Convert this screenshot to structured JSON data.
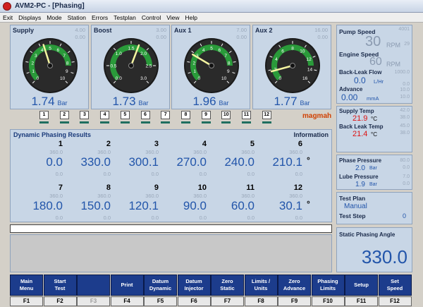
{
  "window": {
    "title": "AVM2-PC - [Phasing]"
  },
  "menu": [
    "Exit",
    "Displays",
    "Mode",
    "Station",
    "Errors",
    "Testplan",
    "Control",
    "View",
    "Help"
  ],
  "gauges": [
    {
      "title": "Supply",
      "max": "4.00",
      "min": "0.00",
      "value": "1.74",
      "unit": "Bar",
      "fraction": 0.435,
      "ticks": [
        "0",
        "1",
        "2",
        "3",
        "4",
        "5",
        "6",
        "7",
        "8",
        "9",
        "10"
      ]
    },
    {
      "title": "Boost",
      "max": "3.00",
      "min": "0.00",
      "value": "1.73",
      "unit": "Bar",
      "fraction": 0.577,
      "ticks": [
        "0.0",
        "0.5",
        "1.0",
        "1.5",
        "2.0",
        "2.5",
        "3.0"
      ]
    },
    {
      "title": "Aux 1",
      "max": "7.00",
      "min": "0.00",
      "value": "1.96",
      "unit": "Bar",
      "fraction": 0.28,
      "ticks": [
        "0",
        "1",
        "2",
        "3",
        "4",
        "5",
        "6",
        "7",
        "8",
        "9",
        "10"
      ]
    },
    {
      "title": "Aux 2",
      "max": "16.00",
      "min": "0.00",
      "value": "1.77",
      "unit": "Bar",
      "fraction": 0.11,
      "ticks": [
        "0",
        "2",
        "4",
        "6",
        "8",
        "10",
        "12",
        "14",
        "16"
      ]
    }
  ],
  "cylinder_buttons": [
    "1",
    "2",
    "3",
    "4",
    "5",
    "6",
    "7",
    "8",
    "9",
    "10",
    "11",
    "12"
  ],
  "logo": "magmah",
  "pump": {
    "pump_speed_label": "Pump Speed",
    "pump_speed_max": "4001",
    "pump_speed_min": "29",
    "pump_speed_value": "30",
    "pump_speed_unit": "RPM",
    "engine_speed_label": "Engine Speed",
    "engine_speed_value": "60",
    "engine_speed_unit": "RPM",
    "backleak_label": "Back-Leak Flow",
    "backleak_max": "1000.0",
    "backleak_min": "0.0",
    "backleak_value": "0.0",
    "backleak_unit": "L/Hr",
    "advance_label": "Advance",
    "advance_max": "10.0",
    "advance_min": "10.0",
    "advance_value": "0.00",
    "advance_unit": "mmA"
  },
  "temps": {
    "supply_label": "Supply Temp",
    "supply_max": "42.0",
    "supply_min": "38.0",
    "supply_value": "21.9",
    "supply_unit": "°C",
    "backleak_label": "Back Leak Temp",
    "backleak_max": "45.0",
    "backleak_min": "38.0",
    "backleak_value": "21.4",
    "backleak_unit": "°C"
  },
  "pressures": {
    "phase_label": "Phase Pressure",
    "phase_max": "80.0",
    "phase_min": "0.0",
    "phase_value": "2.0",
    "phase_unit": "Bar",
    "lube_label": "Lube Pressure",
    "lube_max": "7.0",
    "lube_min": "0.0",
    "lube_value": "1.9",
    "lube_unit": "Bar"
  },
  "testplan": {
    "label": "Test Plan",
    "value": "Manual",
    "step_label": "Test Step",
    "step_value": "0"
  },
  "static_phasing": {
    "label": "Static Phasing Angle",
    "value": "330.0"
  },
  "phasing": {
    "title": "Dynamic Phasing Results",
    "info": "Information",
    "degree": "°",
    "cells": [
      {
        "cyl": "1",
        "max": "360.0",
        "value": "0.0",
        "min": "0.0"
      },
      {
        "cyl": "2",
        "max": "360.0",
        "value": "330.0",
        "min": "0.0"
      },
      {
        "cyl": "3",
        "max": "360.0",
        "value": "300.1",
        "min": "0.0"
      },
      {
        "cyl": "4",
        "max": "360.0",
        "value": "270.0",
        "min": "0.0"
      },
      {
        "cyl": "5",
        "max": "360.0",
        "value": "240.0",
        "min": "0.0"
      },
      {
        "cyl": "6",
        "max": "360.0",
        "value": "210.1",
        "min": "0.0"
      },
      {
        "cyl": "7",
        "max": "360.0",
        "value": "180.0",
        "min": "0.0"
      },
      {
        "cyl": "8",
        "max": "360.0",
        "value": "150.0",
        "min": "0.0"
      },
      {
        "cyl": "9",
        "max": "360.0",
        "value": "120.1",
        "min": "0.0"
      },
      {
        "cyl": "10",
        "max": "360.0",
        "value": "90.0",
        "min": "0.0"
      },
      {
        "cyl": "11",
        "max": "360.0",
        "value": "60.0",
        "min": "0.0"
      },
      {
        "cyl": "12",
        "max": "360.0",
        "value": "30.1",
        "min": "0.0"
      }
    ]
  },
  "fkeys": [
    {
      "label": "Main\nMenu",
      "key": "F1"
    },
    {
      "label": "Start\nTest",
      "key": "F2"
    },
    {
      "label": "",
      "key": "F3"
    },
    {
      "label": "Print",
      "key": "F4"
    },
    {
      "label": "Datum\nDynamic",
      "key": "F5"
    },
    {
      "label": "Datum\nInjector",
      "key": "F6"
    },
    {
      "label": "Zero\nStatic",
      "key": "F7"
    },
    {
      "label": "Limits /\nUnits",
      "key": "F8"
    },
    {
      "label": "Zero\nAdvance",
      "key": "F9"
    },
    {
      "label": "Phasing\nLimits",
      "key": "F10"
    },
    {
      "label": "Setup",
      "key": "F11"
    },
    {
      "label": "Set\nSpeed",
      "key": "F12"
    }
  ]
}
